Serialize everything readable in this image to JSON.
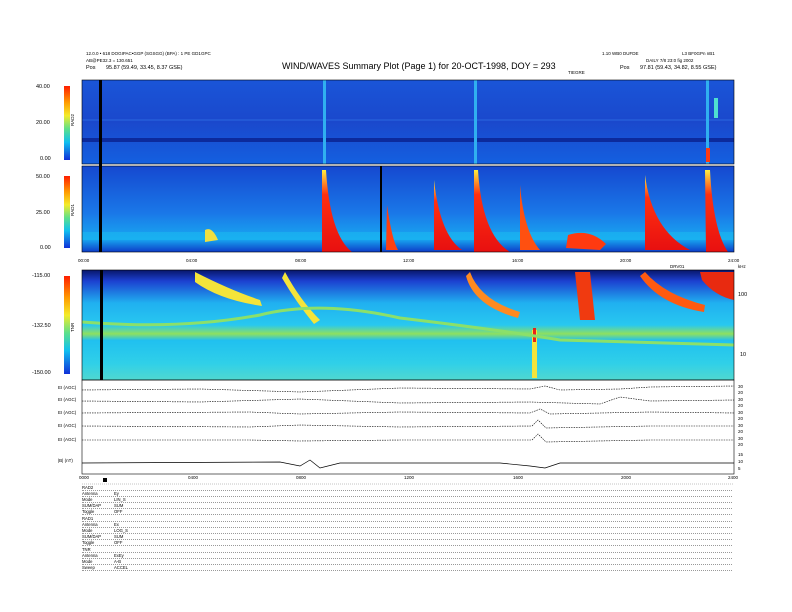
{
  "header": {
    "left_line1": "12.0.0 • 618 DOGIPAC•GGP (SGSGG) (BPA) : 1 PE GD1GPC",
    "left_line2": "AB@PE32.3 = 130.651",
    "left_pos_label": "Pos",
    "left_pos_value": "95.87 (59.49, 33.45, 8.37 GSE)",
    "title": "WIND/WAVES Summary Plot (Page 1) for 20-OCT-1998, DOY = 293",
    "right_line1": "1.10 WB0 DUFDE",
    "right_line1b": "L3 BF0GPn nB1",
    "right_line2": "DAILY 7/8 23:0 fig 2002",
    "right_pos_label": "Pos",
    "right_pos_value": "97.81 (59.43, 34.82, 8.55 GSE)",
    "sub_marker": "TIEGRE"
  },
  "panels": {
    "rad2": {
      "label": "RAD2",
      "ticks": [
        "40.00",
        "20.00",
        "0.00"
      ]
    },
    "rad1": {
      "label": "RAD1",
      "ticks": [
        "50.00",
        "25.00",
        "0.00"
      ]
    },
    "tnr": {
      "label": "TNR",
      "ticks": [
        "-115.00",
        "-132.50",
        "-150.00"
      ],
      "right_ticks": [
        "100",
        "10"
      ],
      "right_unit": "kHz"
    },
    "time_ticks_top": [
      "00:00",
      "04:00",
      "08:00",
      "12:00",
      "16:00",
      "20:00",
      "24:00"
    ],
    "time_marker": "DRV01",
    "traces": [
      {
        "label": "EI (AGC)",
        "ticks": [
          "30",
          "20"
        ]
      },
      {
        "label": "EI (AGC)",
        "ticks": [
          "30",
          "20"
        ]
      },
      {
        "label": "EI (AGC)",
        "ticks": [
          "30",
          "20"
        ]
      },
      {
        "label": "EI (AGC)",
        "ticks": [
          "30",
          "20"
        ]
      },
      {
        "label": "EI (AGC)",
        "ticks": [
          "30",
          "20"
        ]
      },
      {
        "label": "|B| (nT)",
        "ticks": [
          "15",
          "10",
          "5"
        ]
      }
    ],
    "time_ticks_bottom": [
      "0000",
      "0400",
      "0800",
      "1200",
      "1600",
      "2000",
      "2400"
    ]
  },
  "footer": {
    "rows": [
      {
        "k": "RAD2",
        "v": ""
      },
      {
        "k": "Antenna",
        "v": "Ey"
      },
      {
        "k": "Mode",
        "v": "LIN_S"
      },
      {
        "k": "SUM/DAP",
        "v": "SUM"
      },
      {
        "k": "Toggle",
        "v": "OFF"
      },
      {
        "k": "RAD1",
        "v": ""
      },
      {
        "k": "Antenna",
        "v": "Ex"
      },
      {
        "k": "Mode",
        "v": "LOG_S"
      },
      {
        "k": "SUM/DAP",
        "v": "SUM"
      },
      {
        "k": "Toggle",
        "v": "OFF"
      },
      {
        "k": "TNR",
        "v": ""
      },
      {
        "k": "Antenna",
        "v": "ExEy"
      },
      {
        "k": "Mode",
        "v": "A-B"
      },
      {
        "k": "Sweep",
        "v": "ACCEL"
      }
    ]
  },
  "colors": {
    "bg_blue": "#1a4fd8",
    "cyan": "#1ec8e8",
    "green": "#6fe07a",
    "yellow": "#f4e43a",
    "red": "#e8241a",
    "dark": "#07105c"
  },
  "chart_data": [
    {
      "type": "heatmap",
      "title": "RAD2",
      "ylim": [
        0,
        40
      ],
      "xlim_hours": [
        0,
        24
      ],
      "burst_times_hours": [
        0.8,
        9.0,
        14.5,
        23.0,
        23.6
      ]
    },
    {
      "type": "heatmap",
      "title": "RAD1",
      "ylim": [
        0,
        50
      ],
      "xlim_hours": [
        0,
        24
      ],
      "burst_times_hours": [
        0.8,
        9.0,
        11.2,
        13.0,
        14.5,
        17.0,
        19.0,
        20.8,
        23.0,
        23.6
      ]
    },
    {
      "type": "heatmap",
      "title": "TNR",
      "ylim": [
        -150,
        -115
      ],
      "xlim_hours": [
        0,
        24
      ],
      "burst_times_hours": [
        4.3,
        6.8,
        8.0,
        14.5,
        16.8,
        18.5,
        21.0,
        23.0
      ]
    }
  ]
}
